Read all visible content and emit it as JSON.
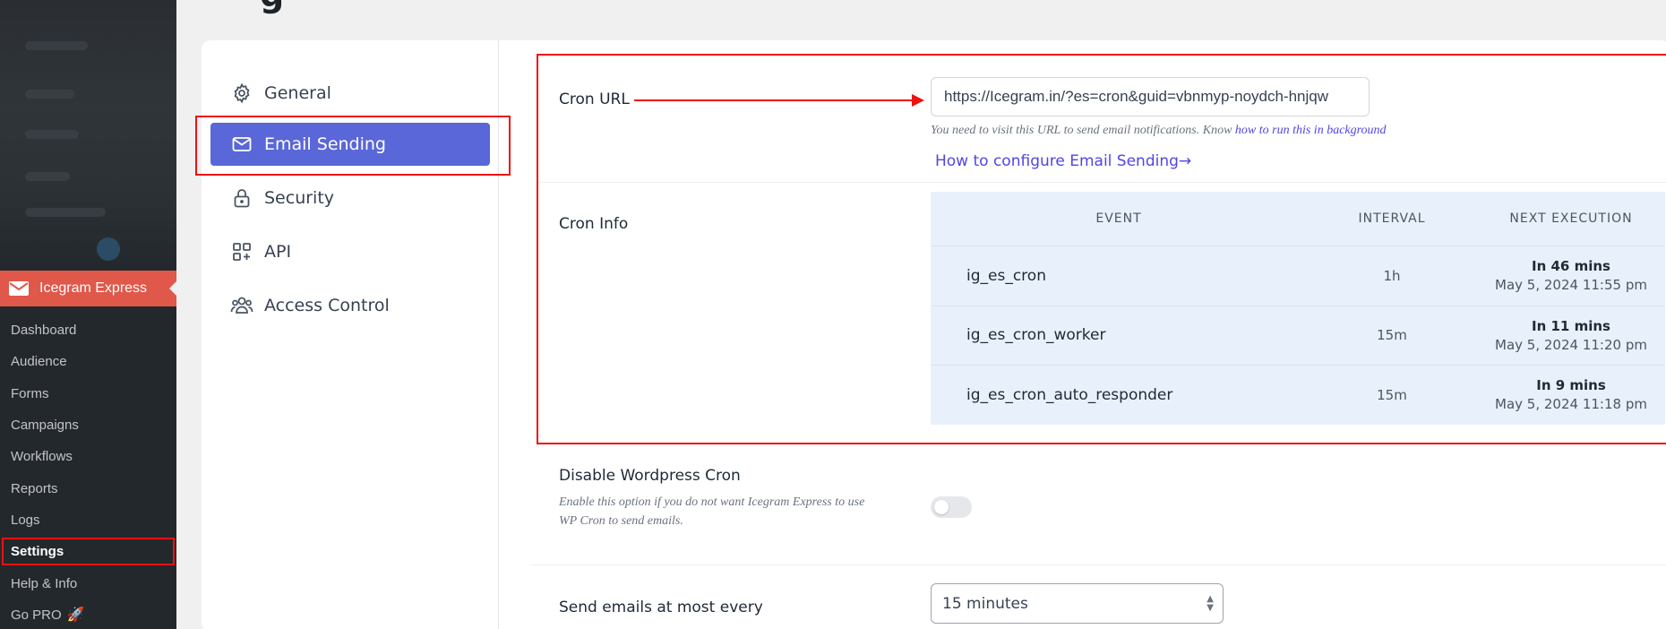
{
  "page": {
    "heading_fragment": "g"
  },
  "wp_menu": {
    "plugin_label": "Icegram Express",
    "submenu": [
      {
        "label": "Dashboard"
      },
      {
        "label": "Audience"
      },
      {
        "label": "Forms"
      },
      {
        "label": "Campaigns"
      },
      {
        "label": "Workflows"
      },
      {
        "label": "Reports"
      },
      {
        "label": "Logs"
      },
      {
        "label": "Settings"
      },
      {
        "label": "Help & Info"
      },
      {
        "label": "Go PRO"
      }
    ],
    "active": "Settings"
  },
  "settings_nav": {
    "items": [
      {
        "label": "General",
        "icon": "gear-icon"
      },
      {
        "label": "Email Sending",
        "icon": "envelope-icon"
      },
      {
        "label": "Security",
        "icon": "lock-icon"
      },
      {
        "label": "API",
        "icon": "api-icon"
      },
      {
        "label": "Access Control",
        "icon": "users-icon"
      }
    ],
    "active": "Email Sending"
  },
  "cron_url": {
    "label": "Cron URL",
    "value": "https://Icegram.in/?es=cron&guid=vbnmyp-noydch-hnjqw",
    "help_prefix": "You need to visit this URL to send email notifications. Know ",
    "help_link": "how to run this in background",
    "config_link": "How to configure Email Sending→"
  },
  "cron_info": {
    "label": "Cron Info",
    "columns": [
      "EVENT",
      "INTERVAL",
      "NEXT EXECUTION"
    ],
    "rows": [
      {
        "event": "ig_es_cron",
        "interval": "1h",
        "next_relative": "In 46 mins",
        "next_absolute": "May 5, 2024 11:55 pm"
      },
      {
        "event": "ig_es_cron_worker",
        "interval": "15m",
        "next_relative": "In 11 mins",
        "next_absolute": "May 5, 2024 11:20 pm"
      },
      {
        "event": "ig_es_cron_auto_responder",
        "interval": "15m",
        "next_relative": "In 9 mins",
        "next_absolute": "May 5, 2024 11:18 pm"
      }
    ]
  },
  "disable_wp_cron": {
    "label": "Disable Wordpress Cron",
    "description": "Enable this option if you do not want Icegram Express to use WP Cron to send emails.",
    "enabled": false
  },
  "send_frequency": {
    "label": "Send emails at most every",
    "selected": "15 minutes"
  },
  "colors": {
    "accent": "#5a67d8",
    "link": "#4f46e5",
    "highlight": "#ee1111",
    "plugin": "#e0584a"
  }
}
